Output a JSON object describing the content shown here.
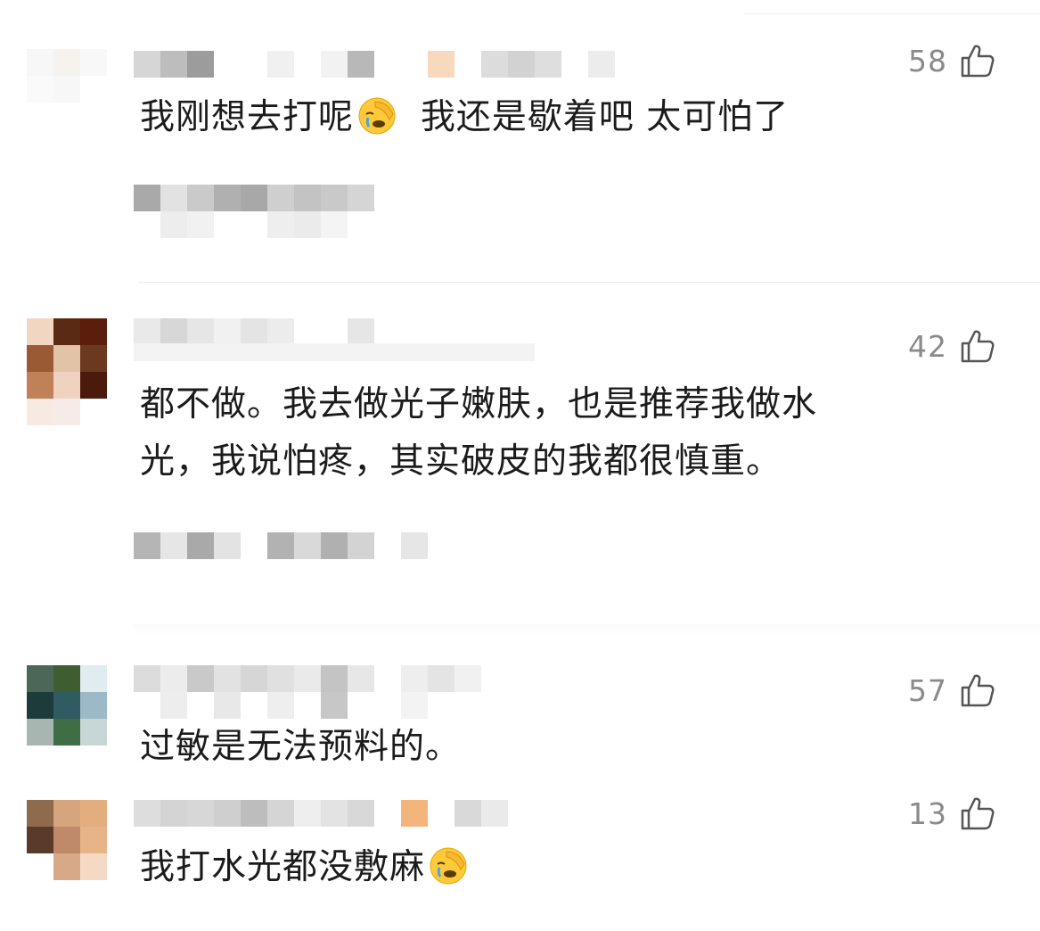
{
  "comments": [
    {
      "text": "我刚想去打呢",
      "text2": "我还是歇着吧 太可怕了",
      "likes": "58",
      "emoji": "facepalm-emoji"
    },
    {
      "text": "都不做。我去做光子嫩肤，也是推荐我做水\n光，我说怕疼，其实破皮的我都很慎重。",
      "likes": "42"
    },
    {
      "text": "过敏是无法预料的。",
      "likes": "57"
    },
    {
      "text": "我打水光都没敷麻",
      "likes": "13",
      "emoji": "facepalm-emoji"
    }
  ],
  "icons": {
    "like": "thumbs-up-icon"
  },
  "colors": {
    "text": "#1b1b1b",
    "meta": "#8a8a8a",
    "divider": "#ececec"
  }
}
